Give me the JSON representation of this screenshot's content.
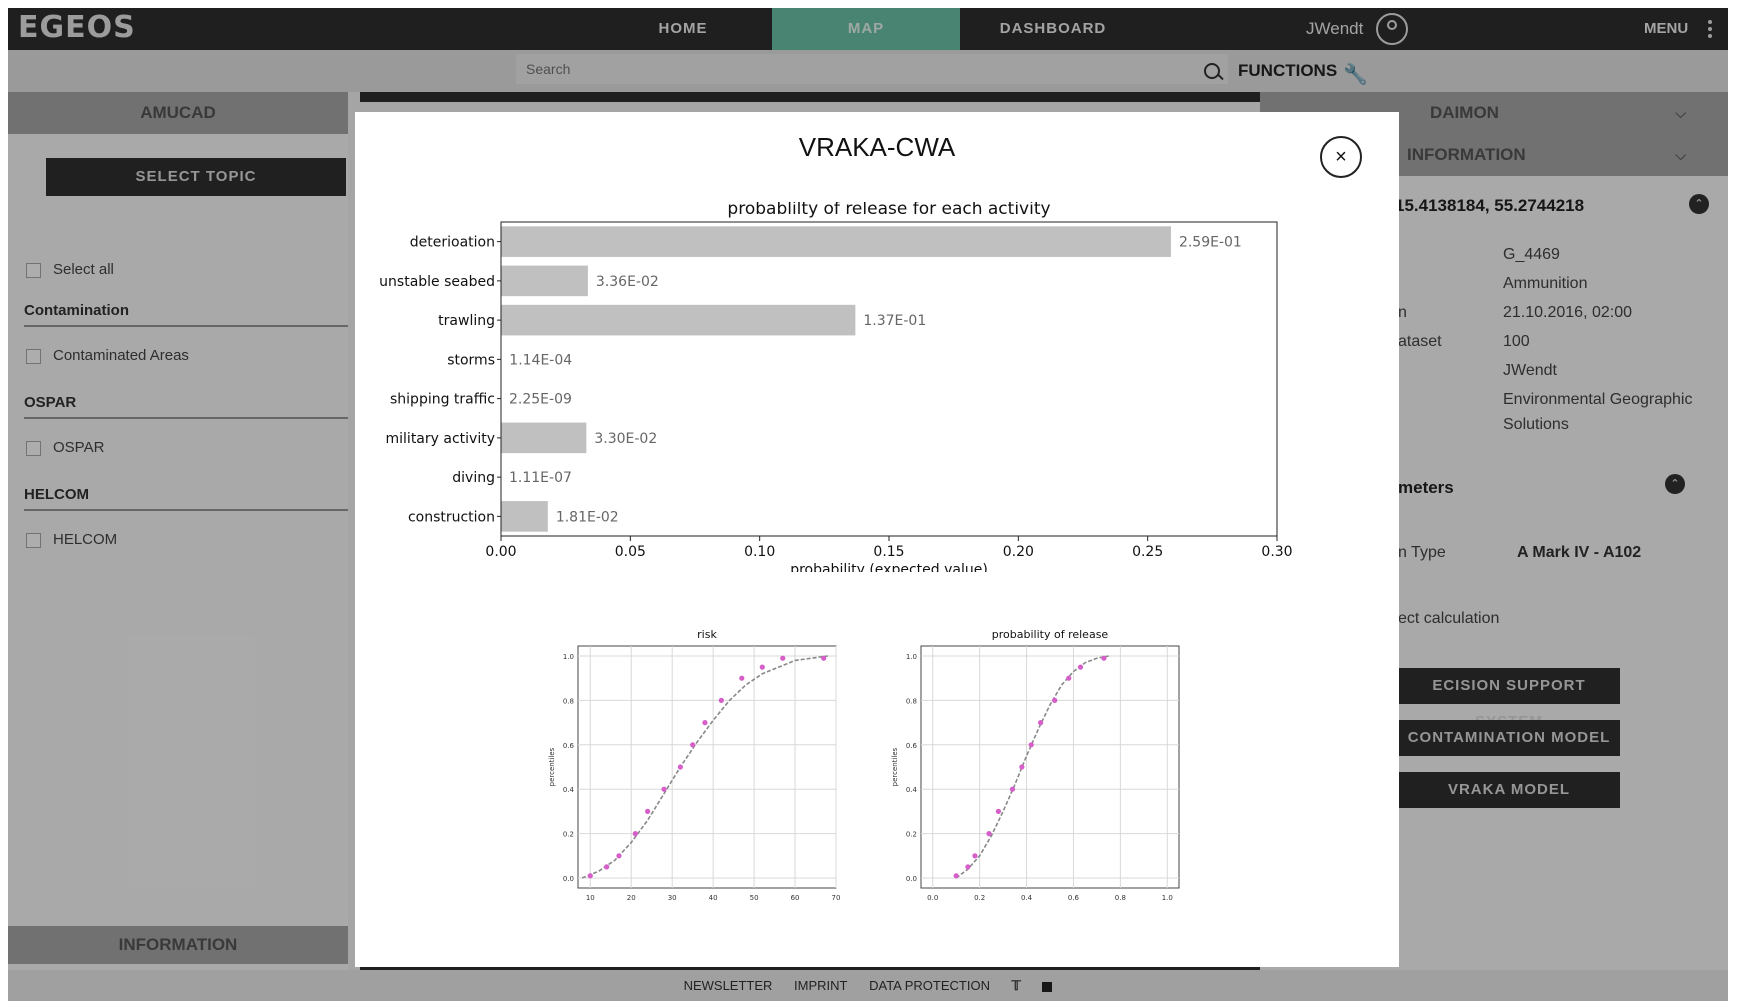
{
  "app": {
    "logo": "EGEOS",
    "nav": {
      "home": "HOME",
      "map": "MAP",
      "dashboard": "DASHBOARD"
    },
    "user": "JWendt",
    "menu": "MENU",
    "search": {
      "placeholder": "Search"
    },
    "functions": "FUNCTIONS"
  },
  "left_panel": {
    "header": "AMUCAD",
    "select_topic": "SELECT TOPIC",
    "select_all": "Select all",
    "groups": [
      {
        "title": "Contamination",
        "item": "Contaminated Areas"
      },
      {
        "title": "OSPAR",
        "item": "OSPAR"
      },
      {
        "title": "HELCOM",
        "item": "HELCOM"
      }
    ],
    "info_header": "INFORMATION"
  },
  "right_panel": {
    "header1": "DAIMON",
    "header2": "INFORMATION",
    "coords": "15.4138184, 55.2744218",
    "rows": [
      {
        "label": "",
        "value": "G_4469"
      },
      {
        "label": "",
        "value": "Ammunition"
      },
      {
        "label": "n",
        "value": "21.10.2016, 02:00"
      },
      {
        "label": "ataset",
        "value": "100"
      },
      {
        "label": "",
        "value": "JWendt"
      },
      {
        "label": "",
        "value": "Environmental Geographic Solutions"
      }
    ],
    "params_header": "meters",
    "type_label": "n Type",
    "type_value": "A Mark IV - A102",
    "calc_label": "ect calculation",
    "btn_dss": "ECISION SUPPORT SYSTEM",
    "btn_contam": "CONTAMINATION MODEL",
    "btn_vraka": "VRAKA MODEL"
  },
  "footer": {
    "newsletter": "NEWSLETTER",
    "imprint": "IMPRINT",
    "data_protection": "DATA PROTECTION"
  },
  "modal": {
    "title": "VRAKA-CWA",
    "close": "×"
  },
  "chart_data": [
    {
      "type": "bar",
      "orientation": "horizontal",
      "title": "probablilty of release for each activity",
      "xlabel": "probability (expected value)",
      "categories": [
        "deterioation",
        "unstable seabed",
        "trawling",
        "storms",
        "shipping traffic",
        "military activity",
        "diving",
        "construction"
      ],
      "values": [
        0.259,
        0.0336,
        0.137,
        0.000114,
        2.25e-09,
        0.033,
        1.11e-07,
        0.0181
      ],
      "labels": [
        "2.59E-01",
        "3.36E-02",
        "1.37E-01",
        "1.14E-04",
        "2.25E-09",
        "3.30E-02",
        "1.11E-07",
        "1.81E-02"
      ],
      "xlim": [
        0,
        0.3
      ],
      "xticks": [
        "0.00",
        "0.05",
        "0.10",
        "0.15",
        "0.20",
        "0.25",
        "0.30"
      ],
      "color": "#c0c0c0"
    },
    {
      "type": "scatter",
      "title": "risk",
      "ylabel": "percentiles",
      "xlim": [
        7,
        70
      ],
      "ylim": [
        0,
        1
      ],
      "xticks": [
        "10",
        "20",
        "30",
        "40",
        "50",
        "60",
        "70"
      ],
      "yticks": [
        "0.0",
        "0.2",
        "0.4",
        "0.6",
        "0.8",
        "1.0"
      ],
      "grid": true,
      "points_x": [
        10,
        14,
        17,
        21,
        24,
        28,
        32,
        35,
        38,
        42,
        47,
        52,
        57,
        67
      ],
      "points_y": [
        0.01,
        0.05,
        0.1,
        0.2,
        0.3,
        0.4,
        0.5,
        0.6,
        0.7,
        0.8,
        0.9,
        0.95,
        0.99,
        0.99
      ],
      "curve_x": [
        8,
        12,
        16,
        20,
        24,
        28,
        32,
        36,
        40,
        44,
        48,
        52,
        56,
        60,
        64,
        68
      ],
      "curve_y": [
        0.0,
        0.03,
        0.08,
        0.16,
        0.26,
        0.38,
        0.5,
        0.61,
        0.71,
        0.8,
        0.87,
        0.92,
        0.95,
        0.98,
        0.99,
        1.0
      ],
      "point_color": "#d55ec8"
    },
    {
      "type": "scatter",
      "title": "probability of release",
      "ylabel": "percentiles",
      "xlim": [
        -0.05,
        1.05
      ],
      "ylim": [
        0,
        1
      ],
      "xticks": [
        "0.0",
        "0.2",
        "0.4",
        "0.6",
        "0.8",
        "1.0"
      ],
      "yticks": [
        "0.0",
        "0.2",
        "0.4",
        "0.6",
        "0.8",
        "1.0"
      ],
      "grid": true,
      "points_x": [
        0.1,
        0.15,
        0.18,
        0.24,
        0.28,
        0.34,
        0.38,
        0.42,
        0.46,
        0.52,
        0.58,
        0.63,
        0.73
      ],
      "points_y": [
        0.01,
        0.05,
        0.1,
        0.2,
        0.3,
        0.4,
        0.5,
        0.6,
        0.7,
        0.8,
        0.9,
        0.95,
        0.99
      ],
      "curve_x": [
        0.1,
        0.15,
        0.2,
        0.25,
        0.3,
        0.35,
        0.4,
        0.45,
        0.5,
        0.55,
        0.6,
        0.65,
        0.7,
        0.75
      ],
      "curve_y": [
        0.0,
        0.04,
        0.1,
        0.19,
        0.3,
        0.42,
        0.55,
        0.67,
        0.78,
        0.87,
        0.93,
        0.97,
        0.99,
        1.0
      ],
      "point_color": "#d55ec8"
    }
  ]
}
